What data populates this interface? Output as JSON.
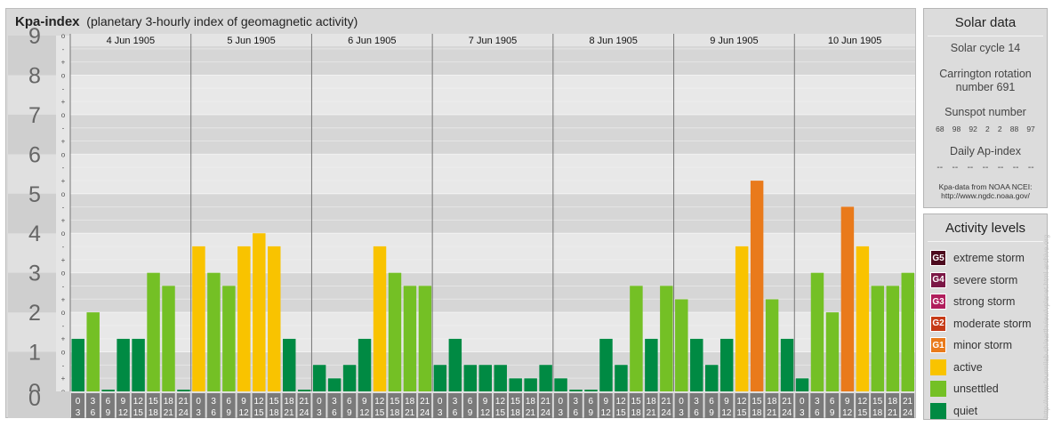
{
  "header": {
    "title": "Kpa-index",
    "subtitle": "(planetary 3-hourly index of geomagnetic activity)"
  },
  "colors": {
    "quiet": "#008a43",
    "unsettled": "#74c025",
    "active": "#f9c300",
    "minor": "#e97a1b",
    "moderate": "#c63a17",
    "strong": "#b01e5c",
    "severe": "#7b1746",
    "extreme": "#4d0a1e"
  },
  "chart_data": {
    "type": "bar",
    "title": "Kpa-index",
    "subtitle": "(planetary 3-hourly index of geomagnetic activity)",
    "ylim": [
      0,
      9
    ],
    "y_major_ticks": [
      "0",
      "1",
      "2",
      "3",
      "4",
      "5",
      "6",
      "7",
      "8",
      "9"
    ],
    "y_minor_labels": [
      "o",
      "+",
      "-"
    ],
    "hour_ranges": [
      "0-3",
      "3-6",
      "6-9",
      "9-12",
      "12-15",
      "15-18",
      "18-21",
      "21-24"
    ],
    "hour_top": [
      "0",
      "3",
      "6",
      "9",
      "12",
      "15",
      "18",
      "21"
    ],
    "hour_bottom": [
      "3",
      "6",
      "9",
      "12",
      "15",
      "18",
      "21",
      "24"
    ],
    "days": [
      {
        "date": "4 Jun 1905",
        "values": [
          1.33,
          2.0,
          0.0,
          1.33,
          1.33,
          3.0,
          2.67,
          0.0
        ]
      },
      {
        "date": "5 Jun 1905",
        "values": [
          3.67,
          3.0,
          2.67,
          3.67,
          4.0,
          3.67,
          1.33,
          0.0
        ]
      },
      {
        "date": "6 Jun 1905",
        "values": [
          0.67,
          0.33,
          0.67,
          1.33,
          3.67,
          3.0,
          2.67,
          2.67
        ]
      },
      {
        "date": "7 Jun 1905",
        "values": [
          0.67,
          1.33,
          0.67,
          0.67,
          0.67,
          0.33,
          0.33,
          0.67
        ]
      },
      {
        "date": "8 Jun 1905",
        "values": [
          0.33,
          0.0,
          0.0,
          1.33,
          0.67,
          2.67,
          1.33,
          2.67
        ]
      },
      {
        "date": "9 Jun 1905",
        "values": [
          2.33,
          1.33,
          0.67,
          1.33,
          3.67,
          5.33,
          2.33,
          1.33
        ]
      },
      {
        "date": "10 Jun 1905",
        "values": [
          0.33,
          3.0,
          2.0,
          4.67,
          3.67,
          2.67,
          2.67,
          3.0
        ]
      }
    ]
  },
  "solar": {
    "title": "Solar data",
    "cycle": "Solar cycle 14",
    "carrington_line1": "Carrington rotation",
    "carrington_line2": "number 691",
    "sunspot_title": "Sunspot number",
    "sunspots": [
      "68",
      "98",
      "92",
      "2",
      "2",
      "88",
      "97"
    ],
    "ap_title": "Daily Ap-index",
    "ap_values": [
      "--",
      "--",
      "--",
      "--",
      "--",
      "--",
      "--"
    ],
    "source_line1": "Kpa-data from NOAA NCEI:",
    "source_line2": "http://www.ngdc.noaa.gov/"
  },
  "levels": {
    "title": "Activity levels",
    "items": [
      {
        "badge": "G5",
        "label": "extreme storm",
        "color": "#4d0a1e"
      },
      {
        "badge": "G4",
        "label": "severe storm",
        "color": "#7b1746"
      },
      {
        "badge": "G3",
        "label": "strong storm",
        "color": "#b01e5c"
      },
      {
        "badge": "G2",
        "label": "moderate storm",
        "color": "#c63a17"
      },
      {
        "badge": "G1",
        "label": "minor storm",
        "color": "#e97a1b"
      },
      {
        "badge": "",
        "label": "active",
        "color": "#f9c300"
      },
      {
        "badge": "",
        "label": "unsettled",
        "color": "#74c025"
      },
      {
        "badge": "",
        "label": "quiet",
        "color": "#008a43"
      }
    ]
  },
  "credit": "http://www.fourmilab.ch/earthview/vplanet.html  archive.org"
}
